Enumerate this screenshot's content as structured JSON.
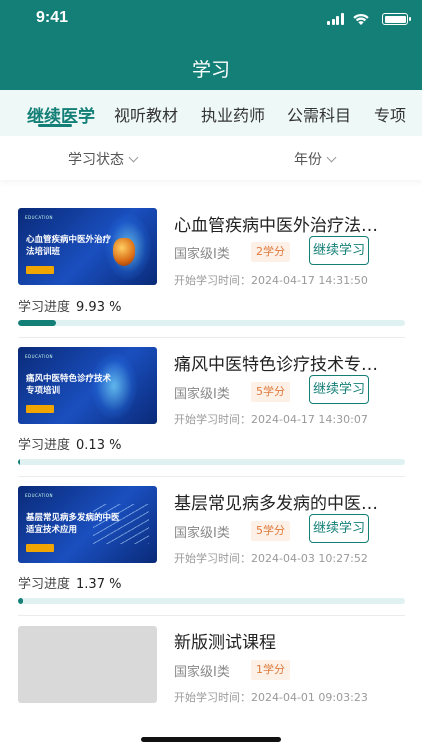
{
  "status_bar": {
    "time": "9:41"
  },
  "header": {
    "title": "学习"
  },
  "tabs": [
    {
      "label": "继续医学",
      "active": true
    },
    {
      "label": "视听教材",
      "active": false
    },
    {
      "label": "执业药师",
      "active": false
    },
    {
      "label": "公需科目",
      "active": false
    },
    {
      "label": "专项",
      "active": false
    }
  ],
  "filters": {
    "status_label": "学习状态",
    "year_label": "年份"
  },
  "colors": {
    "accent": "#137f77",
    "credit_text": "#e07a3d"
  },
  "courses": [
    {
      "title": "心血管疾病中医外治疗法培训班",
      "thumb_text": "心血管疾病中医外治疗法培训班",
      "thumb_logo": "EDUCATION",
      "level": "国家级Ⅰ类",
      "credits": "2学分",
      "continue_label": "继续学习",
      "start_time": "开始学习时间：2024-04-17 14:31:50",
      "progress_label": "学习进度",
      "progress_text": "9.93 %",
      "progress": 9.93
    },
    {
      "title": "痛风中医特色诊疗技术专项培训",
      "thumb_text": "痛风中医特色诊疗技术专项培训",
      "thumb_logo": "EDUCATION",
      "level": "国家级Ⅰ类",
      "credits": "5学分",
      "continue_label": "继续学习",
      "start_time": "开始学习时间：2024-04-17 14:30:07",
      "progress_label": "学习进度",
      "progress_text": "0.13 %",
      "progress": 0.13
    },
    {
      "title": "基层常见病多发病的中医适宜技术应用",
      "thumb_text": "基层常见病多发病的中医适宜技术应用",
      "thumb_logo": "EDUCATION",
      "level": "国家级Ⅰ类",
      "credits": "5学分",
      "continue_label": "继续学习",
      "start_time": "开始学习时间：2024-04-03 10:27:52",
      "progress_label": "学习进度",
      "progress_text": "1.37 %",
      "progress": 1.37
    },
    {
      "title": "新版测试课程",
      "level": "国家级Ⅰ类",
      "credits": "1学分",
      "start_time": "开始学习时间：2024-04-01 09:03:23"
    }
  ]
}
